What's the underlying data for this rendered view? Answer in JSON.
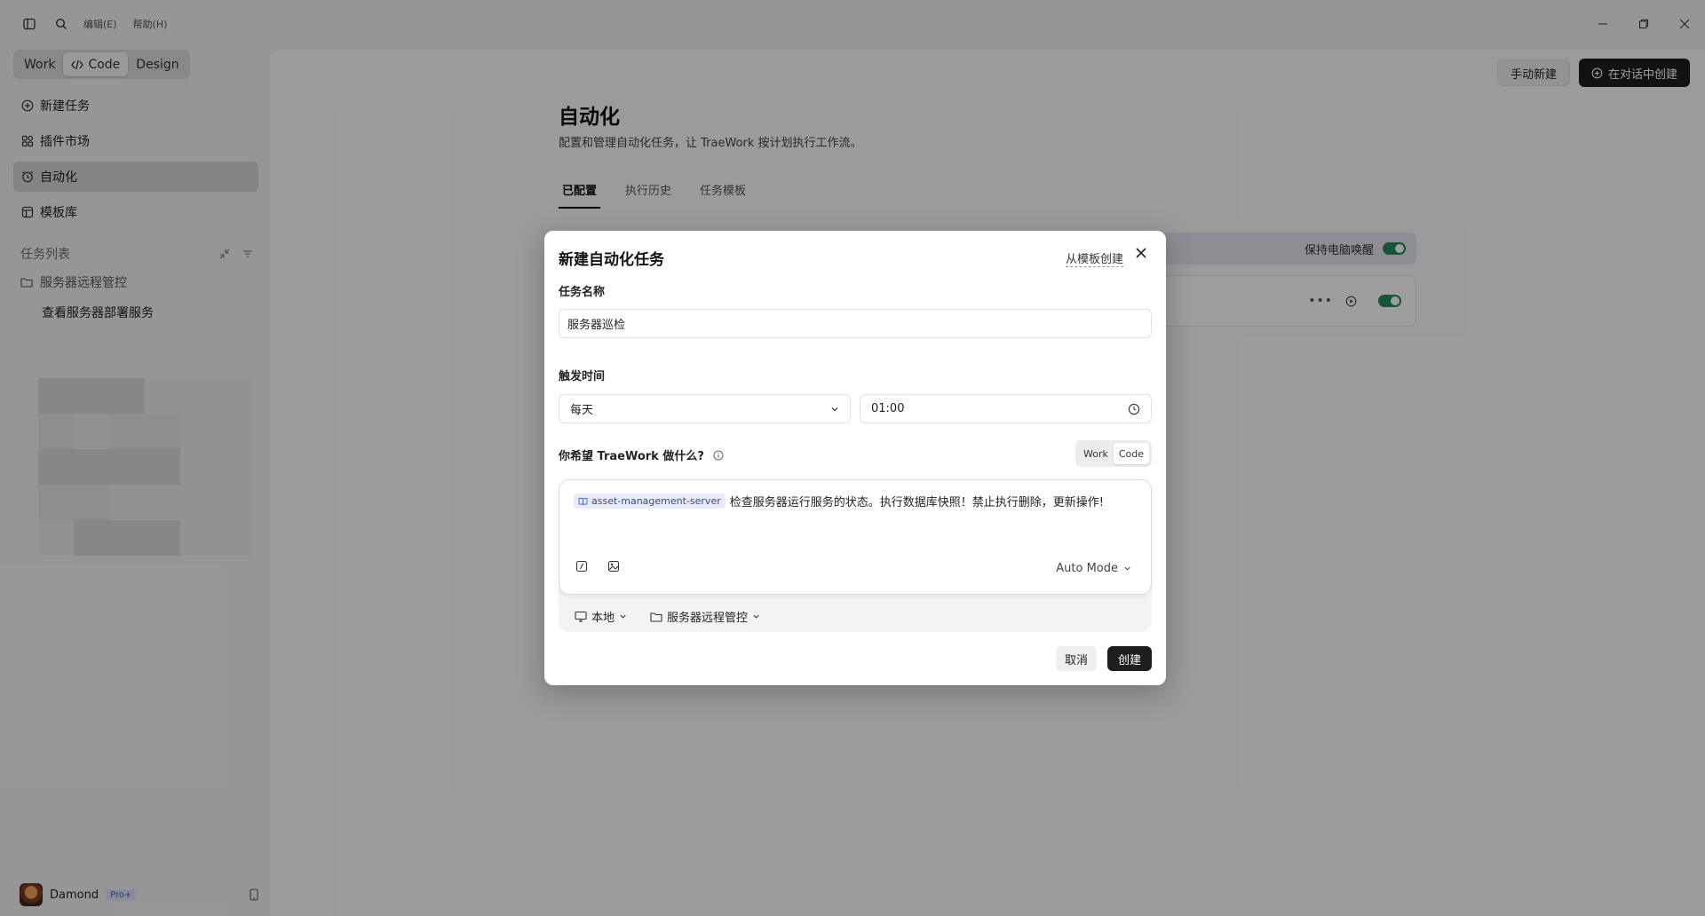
{
  "titlebar": {
    "menus": [
      "编辑(E)",
      "帮助(H)"
    ]
  },
  "sidebar": {
    "modes": [
      "Work",
      "Code",
      "Design"
    ],
    "active_mode": "Code",
    "nav": [
      {
        "label": "新建任务",
        "icon": "plus-circle-icon"
      },
      {
        "label": "插件市场",
        "icon": "plugin-icon"
      },
      {
        "label": "自动化",
        "icon": "alarm-clock-icon"
      },
      {
        "label": "模板库",
        "icon": "template-icon"
      }
    ],
    "active_nav": "自动化",
    "tasks_header": "任务列表",
    "folder": "服务器远程管控",
    "task": "查看服务器部署服务"
  },
  "user": {
    "name": "Damond",
    "badge": "Pro+"
  },
  "main": {
    "manual_button": "手动新建",
    "chat_button": "在对话中创建",
    "title": "自动化",
    "description": "配置和管理自动化任务，让 TraeWork 按计划执行工作流。",
    "tabs": [
      "已配置",
      "执行历史",
      "任务模板"
    ],
    "active_tab": "已配置",
    "banner_text": "保持电脑唤醒",
    "banner_toggle_on": true,
    "task_toggle_on": true
  },
  "modal": {
    "title": "新建自动化任务",
    "template_link": "从模板创建",
    "name_label": "任务名称",
    "name_value": "服务器巡检",
    "trigger_label": "触发时间",
    "frequency": "每天",
    "time": "01:00",
    "prompt_label": "你希望 TraeWork 做什么?",
    "prompt_modes": [
      "Work",
      "Code"
    ],
    "active_prompt_mode": "Code",
    "chip": "asset-management-server",
    "prompt_text": "检查服务器运行服务的状态。执行数据库快照！禁止执行删除，更新操作!",
    "auto_mode": "Auto Mode",
    "env": "本地",
    "workspace": "服务器远程管控",
    "cancel": "取消",
    "create": "创建"
  },
  "colors": {
    "accent_dark": "#1e1e1e",
    "toggle_green": "#1f8a55",
    "chip_bg": "#e7ecf8"
  }
}
